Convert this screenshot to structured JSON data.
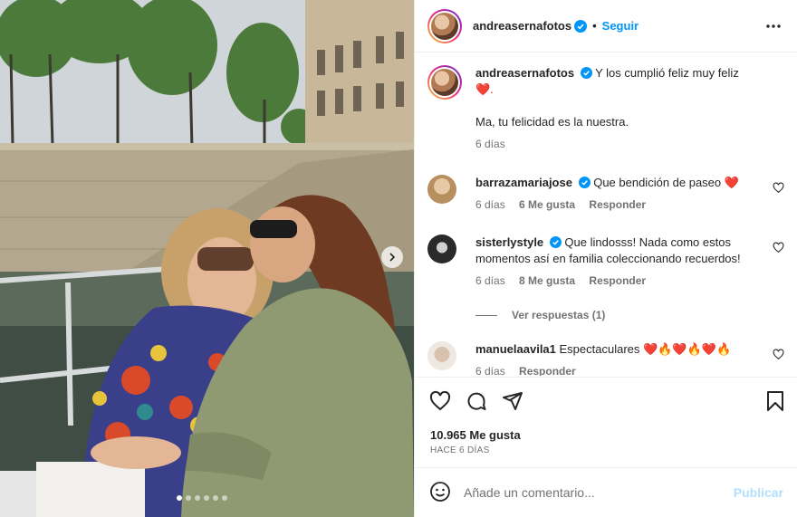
{
  "header": {
    "username": "andreasernafotos",
    "separator": "•",
    "follow_label": "Seguir"
  },
  "caption": {
    "username": "andreasernafotos",
    "text_line1": "Y los cumplió feliz muy feliz",
    "emoji_line2": "❤️.",
    "text_line3": "Ma, tu felicidad es la nuestra.",
    "time": "6 días"
  },
  "comments": [
    {
      "username": "barrazamariajose",
      "text": "Que bendición de paseo ❤️",
      "time": "6 días",
      "likes": "6 Me gusta",
      "reply": "Responder"
    },
    {
      "username": "sisterlystyle",
      "text": "Que lindosss! Nada como estos momentos así en familia coleccionando recuerdos!",
      "time": "6 días",
      "likes": "8 Me gusta",
      "reply": "Responder"
    },
    {
      "username": "manuelaavila1",
      "text": "Espectaculares ❤️🔥❤️🔥❤️🔥",
      "time": "6 días",
      "reply": "Responder"
    }
  ],
  "view_replies": "Ver respuestas (1)",
  "likes_text": "10.965 Me gusta",
  "time_ago": "HACE 6 DÍAS",
  "comment_input": {
    "placeholder": "Añade un comentario..."
  },
  "publish_label": "Publicar",
  "colors": {
    "link": "#0095f6",
    "publish_disabled": "#b2dffc",
    "heart": "#ed1c24"
  },
  "carousel": {
    "total": 6,
    "active": 0
  },
  "icons": [
    "verified-icon",
    "more-icon",
    "heart-icon",
    "comment-icon",
    "share-icon",
    "save-icon",
    "emoji-icon",
    "chevron-right-icon"
  ]
}
